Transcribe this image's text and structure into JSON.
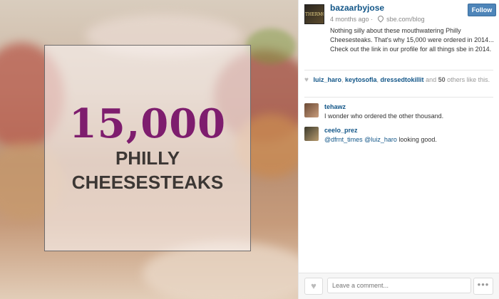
{
  "photo": {
    "headline_number": "15,000",
    "headline_line1": "PHILLY",
    "headline_line2": "CHEESESTEAKS"
  },
  "post": {
    "avatar_text": "THERMO",
    "username": "bazaarbyjose",
    "follow_label": "Follow",
    "time_ago": "4 months ago",
    "separator": "·",
    "location": "sbe.com/blog",
    "caption": "Nothing silly about these mouthwatering Philly Cheesesteaks. That's why 15,000 were ordered in 2014... Check out the link in our profile for all things sbe in 2014."
  },
  "likes": {
    "user1": "luiz_haro",
    "user2": "keytosofla",
    "user3": "dressedtokillit",
    "and_text": "and",
    "count": "50",
    "suffix": "others like this."
  },
  "comments": [
    {
      "user": "tehawz",
      "text": "I wonder who ordered the other thousand."
    },
    {
      "user": "ceelo_prez",
      "mention1": "@dfrnt_times",
      "mention2": "@luiz_haro",
      "text": "looking good."
    }
  ],
  "input": {
    "placeholder": "Leave a comment..."
  },
  "more_label": "•••",
  "colors": {
    "link_blue": "#125688",
    "headline_purple": "#7e1d6e",
    "follow_blue": "#4e85b9"
  },
  "icons": [
    "location-pin-icon",
    "heart-icon",
    "more-icon"
  ]
}
